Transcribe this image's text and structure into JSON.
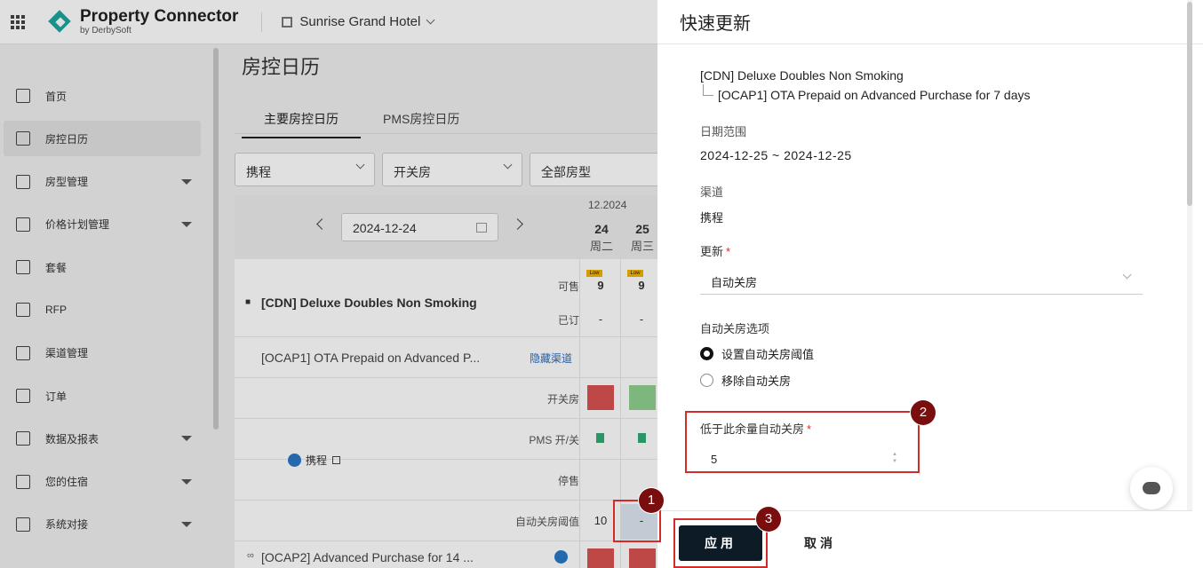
{
  "header": {
    "brand": "Property Connector",
    "brand_sub": "by DerbySoft",
    "hotel": "Sunrise Grand Hotel"
  },
  "sidebar": {
    "items": [
      {
        "label": "首页",
        "icon": "home-icon"
      },
      {
        "label": "房控日历",
        "icon": "calendar-icon"
      },
      {
        "label": "房型管理",
        "icon": "room-type-icon"
      },
      {
        "label": "价格计划管理",
        "icon": "rate-plan-icon"
      },
      {
        "label": "套餐",
        "icon": "package-icon"
      },
      {
        "label": "RFP",
        "icon": "rfp-icon"
      },
      {
        "label": "渠道管理",
        "icon": "channel-icon"
      },
      {
        "label": "订单",
        "icon": "order-icon"
      },
      {
        "label": "数据及报表",
        "icon": "report-icon"
      },
      {
        "label": "您的住宿",
        "icon": "property-icon"
      },
      {
        "label": "系统对接",
        "icon": "connection-icon"
      }
    ]
  },
  "main": {
    "title": "房控日历",
    "tabs": [
      "主要房控日历",
      "PMS房控日历"
    ],
    "filters": [
      "携程",
      "开关房",
      "全部房型"
    ],
    "date": "2024-12-24",
    "month": "12.2024",
    "days": [
      {
        "num": "24",
        "weekday": "周二"
      },
      {
        "num": "25",
        "weekday": "周三"
      }
    ],
    "room": "[CDN] Deluxe Doubles Non Smoking",
    "row_labels": {
      "available": "可售",
      "booked": "已订",
      "open_close": "开关房",
      "pms": "PMS 开/关",
      "stop_sell": "停售",
      "auto_close": "自动关房阈值"
    },
    "badge": "Low",
    "available_values": [
      "9",
      "9"
    ],
    "booked_values": [
      "-",
      "-"
    ],
    "auto_close_values": [
      "10",
      "-"
    ],
    "rate_plan_1": "[OCAP1] OTA Prepaid on Advanced P...",
    "hide_channel": "隐藏渠道",
    "channel": "携程",
    "rate_plan_2": "[OCAP2] Advanced Purchase for 14 ..."
  },
  "drawer": {
    "title": "快速更新",
    "room": "[CDN] Deluxe Doubles Non Smoking",
    "rate_plan": "[OCAP1] OTA Prepaid on Advanced Purchase for 7 days",
    "date_range_label": "日期范围",
    "date_range": "2024-12-25 ~ 2024-12-25",
    "channel_label": "渠道",
    "channel": "携程",
    "update_label": "更新",
    "required_mark": "*",
    "update_value": "自动关房",
    "auto_close_options_label": "自动关房选项",
    "options": [
      "设置自动关房阈值",
      "移除自动关房"
    ],
    "threshold_label": "低于此余量自动关房",
    "threshold_value": "5",
    "apply": "应用",
    "cancel": "取消"
  },
  "annotations": [
    "1",
    "2",
    "3"
  ],
  "colors": {
    "highlight": "#d42a2a",
    "marker": "#7a0d0d",
    "closed": "#d9534f",
    "open": "#8fd18f",
    "brand": "#1aa6a0"
  }
}
